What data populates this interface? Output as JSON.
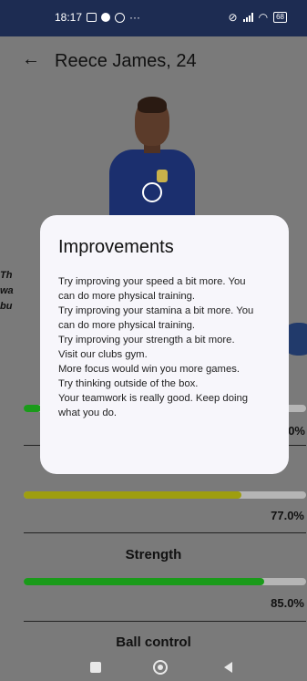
{
  "status_bar": {
    "time": "18:17",
    "icons": [
      "message-icon",
      "notification-dot-icon",
      "whatsapp-icon",
      "more-icon"
    ],
    "more": "···",
    "battery": "68"
  },
  "header": {
    "back_icon": "←",
    "title": "Reece  James, 24"
  },
  "background_text": {
    "line1": "Th",
    "line2": "wa",
    "line3": "bu"
  },
  "stats": [
    {
      "name": "",
      "percent": ".0%",
      "fraction": 0.06,
      "color": "#1a9a1a"
    },
    {
      "name": "",
      "percent": "77.0%",
      "fraction": 0.77,
      "color": "#9e9e10"
    },
    {
      "name": "Strength",
      "percent": "85.0%",
      "fraction": 0.85,
      "color": "#1a9a1a"
    },
    {
      "name": "Ball control",
      "percent": "",
      "fraction": null,
      "color": ""
    }
  ],
  "dialog": {
    "title": "Improvements",
    "lines": [
      "Try improving your speed a bit more. You",
      "can do more physical training.",
      "Try improving your stamina a bit more. You",
      "can do more physical training.",
      "Try improving your strength a bit more.",
      "Visit our clubs gym.",
      "More focus would win you more games.",
      "Try thinking outside of the box.",
      "Your teamwork is really good. Keep doing",
      "what you do."
    ]
  },
  "colors": {
    "status_bar": "#1d2c52",
    "overlay_background": "#7a7a7a",
    "dialog_background": "#f7f6fb",
    "green_bar": "#1a9a1a",
    "olive_bar": "#9e9e10",
    "track": "#b5b5b5"
  }
}
